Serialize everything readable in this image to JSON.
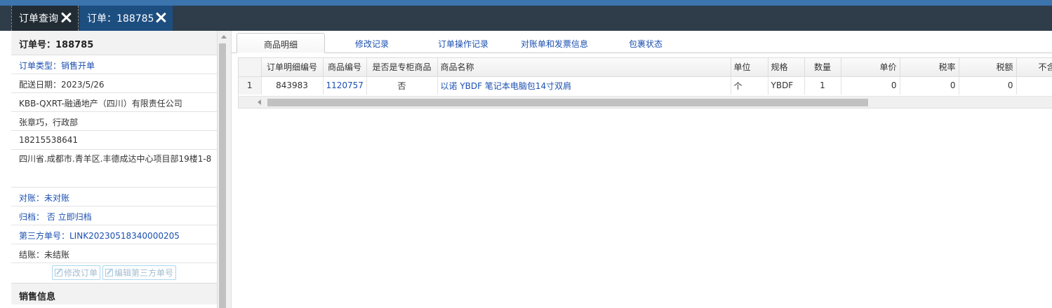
{
  "window_tabs": [
    {
      "label": "订单查询"
    },
    {
      "label": "订单：188785"
    }
  ],
  "order_panel": {
    "title": "订单号：188785",
    "rows": [
      {
        "text": "订单类型：销售开单"
      },
      {
        "text": "配送日期：2023/5/26"
      },
      {
        "text": "KBB-QXRT-融通地产（四川）有限责任公司"
      },
      {
        "text": "张章巧，行政部"
      },
      {
        "text": "18215538641"
      },
      {
        "text": "四川省.成都市.青羊区.丰德成达中心项目部19楼1-8"
      },
      {
        "text": "对账：未对账"
      },
      {
        "text": "归档：  否 立即归档"
      },
      {
        "text": "第三方单号：LINK20230518340000205"
      },
      {
        "text": "结账：未结账"
      }
    ],
    "buttons": {
      "edit_order": "修改订单",
      "edit_third_party": "编辑第三方单号"
    },
    "sales_section": "销售信息"
  },
  "detail_tabs": [
    {
      "label": "商品明细"
    },
    {
      "label": "修改记录"
    },
    {
      "label": "订单操作记录"
    },
    {
      "label": "对账单和发票信息"
    },
    {
      "label": "包裹状态"
    }
  ],
  "table": {
    "columns": [
      "订单明细编号",
      "商品编号",
      "是否是专柜商品",
      "商品名称",
      "单位",
      "规格",
      "数量",
      "单价",
      "税率",
      "税额",
      "不含税"
    ],
    "rows": [
      {
        "rownum": "1",
        "detail_id": "843983",
        "product_id": "1120757",
        "counter": "否",
        "name": "以诺 YBDF 笔记本电脑包14寸双肩",
        "unit": "个",
        "spec": "YBDF",
        "qty": "1",
        "price": "0",
        "tax_rate": "0",
        "tax": "0"
      }
    ]
  },
  "colors": {
    "accent_blue": "#1b4fb0",
    "tabbar": "#2f3d4a",
    "active_tab": "#1d4e80",
    "top_strip": "#3c74ae"
  }
}
